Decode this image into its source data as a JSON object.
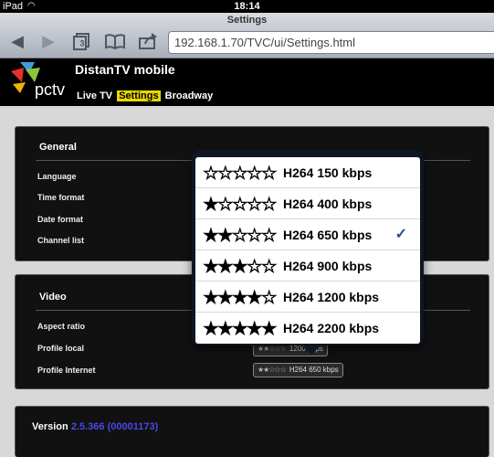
{
  "status": {
    "device": "iPad",
    "time": "18:14"
  },
  "browser": {
    "title": "Settings",
    "url": "192.168.1.70/TVC/ui/Settings.html"
  },
  "app": {
    "title": "DistanTV mobile",
    "tabs": [
      {
        "label": "Live TV",
        "active": false
      },
      {
        "label": "Settings",
        "active": true
      },
      {
        "label": "Broadway",
        "active": false
      }
    ]
  },
  "general": {
    "title": "General",
    "rows": [
      "Language",
      "Time format",
      "Date format",
      "Channel list"
    ]
  },
  "video": {
    "title": "Video",
    "rows": [
      "Aspect ratio",
      "Profile local",
      "Profile Internet"
    ],
    "profile_local": {
      "stars": "★★☆☆☆",
      "value": "1200 kbps"
    },
    "profile_internet": {
      "stars": "★★☆☆☆",
      "value": "H264 650 kbps"
    }
  },
  "version": {
    "label": "Version",
    "value": "2.5.366 (00001173)"
  },
  "popover": {
    "options": [
      {
        "stars": "☆☆☆☆☆",
        "label": "H264 150 kbps"
      },
      {
        "stars": "★☆☆☆☆",
        "label": "H264 400 kbps"
      },
      {
        "stars": "★★☆☆☆",
        "label": "H264 650 kbps",
        "selected": true,
        "check": "✓"
      },
      {
        "stars": "★★★☆☆",
        "label": "H264 900 kbps"
      },
      {
        "stars": "★★★★☆",
        "label": "H264 1200 kbps"
      },
      {
        "stars": "★★★★★",
        "label": "H264 2200 kbps"
      }
    ]
  }
}
